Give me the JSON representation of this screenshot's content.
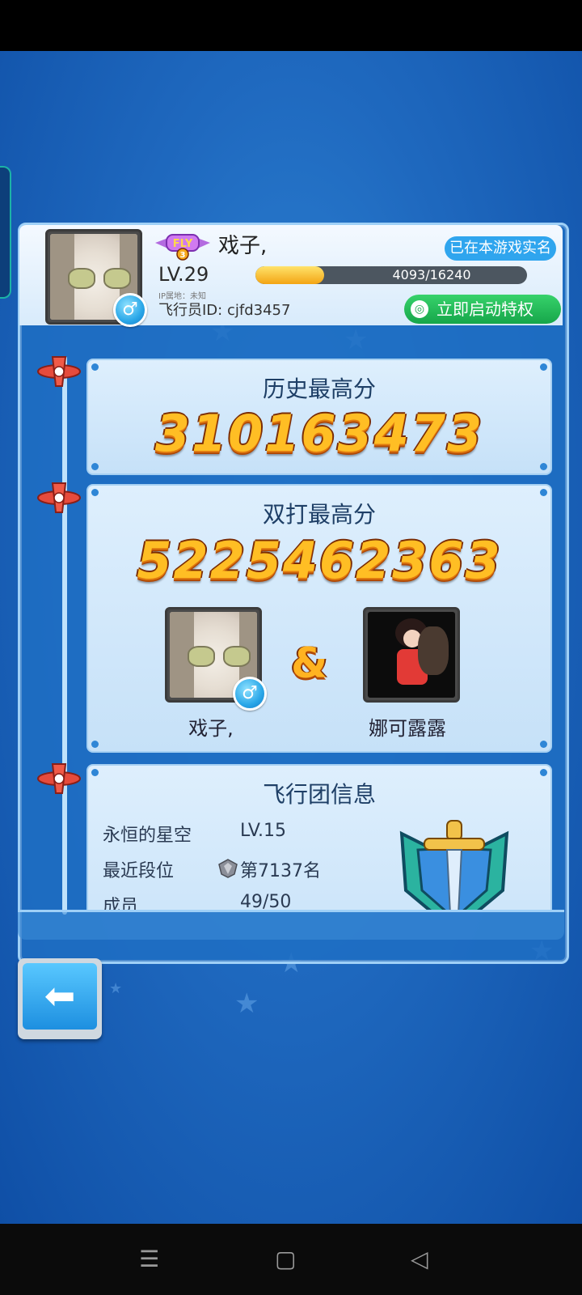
{
  "profile": {
    "name": "戏子,",
    "realname_badge": "已在本游戏实名",
    "fly_badge_text": "FLY",
    "fly_badge_num": "3",
    "level": "LV.29",
    "exp_text": "4093/16240",
    "exp_progress": 0.252,
    "ip_label": "IP属地：未知",
    "pilot_id": "飞行员ID: cjfd3457",
    "privilege_button": "立即启动特权",
    "gender_icon": "male-icon"
  },
  "history": {
    "title": "历史最高分",
    "score": "310163473"
  },
  "duo": {
    "title": "双打最高分",
    "score": "5225462363",
    "ampersand": "&",
    "partner1_name": "戏子,",
    "partner2_name": "娜可露露"
  },
  "guild": {
    "title": "飞行团信息",
    "name": "永恒的星空",
    "level": "LV.15",
    "rank_label": "最近段位",
    "rank_value": "第7137名",
    "members_label": "成员",
    "members_value": "49/50"
  },
  "back_button_icon": "arrow-left-icon",
  "colors": {
    "background": "#1f69bf",
    "card": "#deeffd",
    "score": "#ffbe24",
    "privilege": "#16a64a",
    "realname": "#2fa5ee"
  }
}
